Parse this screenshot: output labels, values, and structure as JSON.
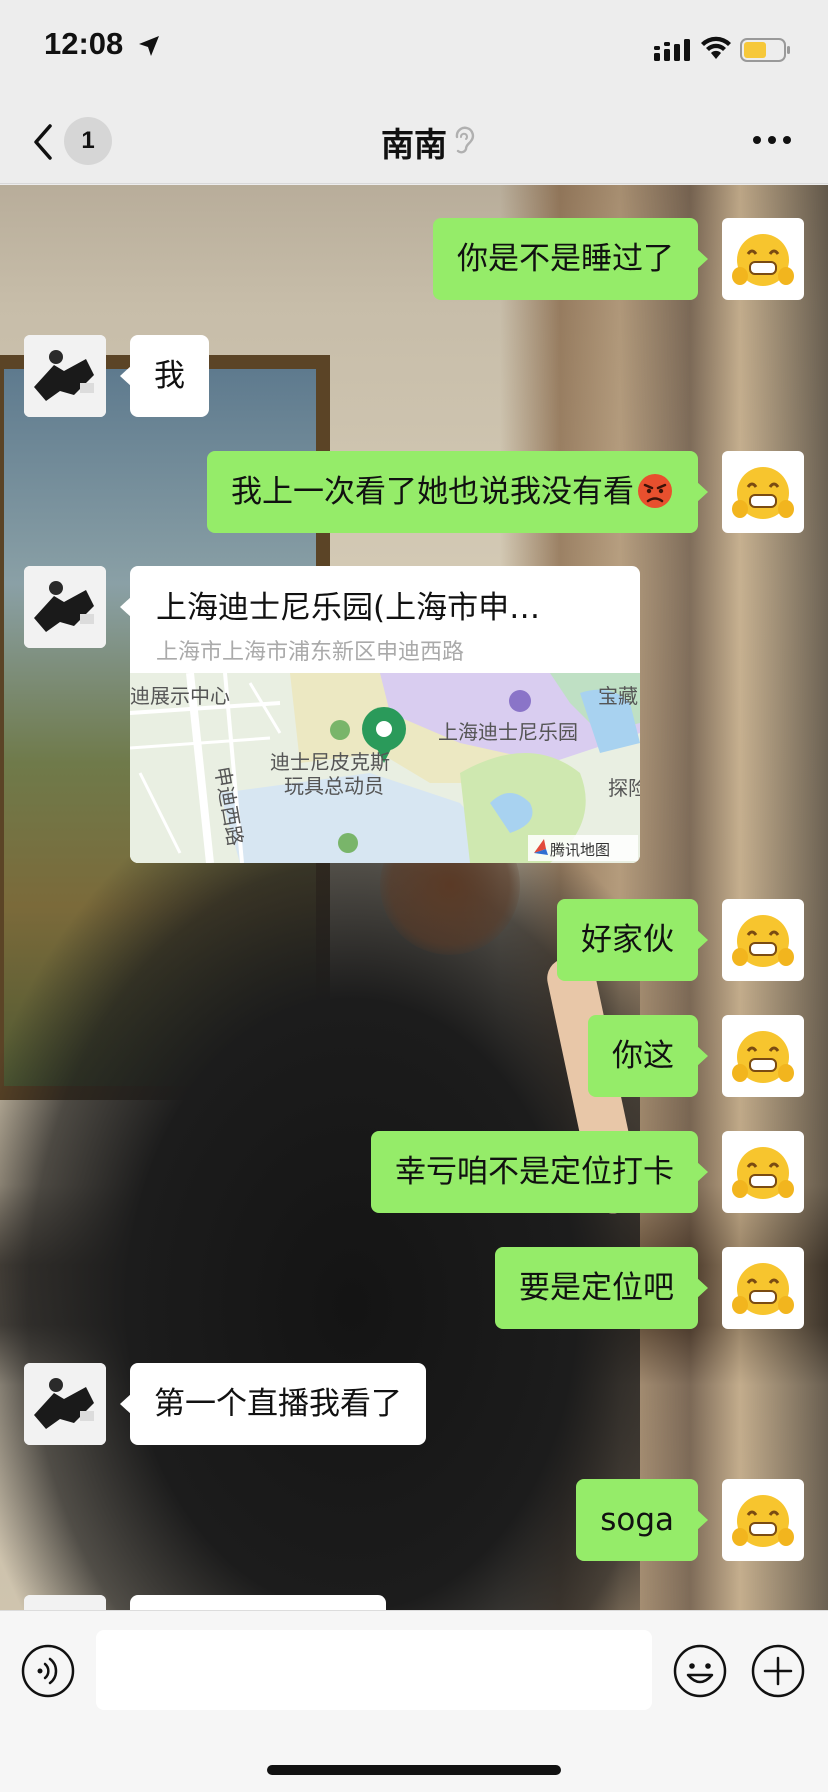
{
  "status_bar": {
    "time": "12:08",
    "icons": [
      "location-arrow-icon",
      "signal-icon",
      "wifi-icon",
      "battery-icon"
    ],
    "battery_color": "#f6c83a"
  },
  "nav": {
    "unread_count": "1",
    "title": "南南",
    "icons": [
      "back-icon",
      "ear-icon",
      "more-icon"
    ]
  },
  "colors": {
    "sent_bubble": "#95ec69",
    "received_bubble": "#ffffff",
    "bar_background": "#ededed"
  },
  "messages": [
    {
      "sender": "me",
      "text": "你是不是睡过了"
    },
    {
      "sender": "them",
      "text": "我"
    },
    {
      "sender": "me",
      "text": "我上一次看了她也说我没有看",
      "emoji": "angry-face-icon"
    },
    {
      "sender": "them",
      "type": "location",
      "title": "上海迪士尼乐园(上海市申…",
      "address": "上海市上海市浦东新区申迪西路",
      "map_labels": [
        "迪展示中心",
        "申迪西路",
        "迪士尼皮克斯",
        "玩具总动员",
        "上海迪士尼乐园",
        "宝藏",
        "探险",
        "腾讯地图"
      ]
    },
    {
      "sender": "me",
      "text": "好家伙"
    },
    {
      "sender": "me",
      "text": "你这"
    },
    {
      "sender": "me",
      "text": "幸亏咱不是定位打卡"
    },
    {
      "sender": "me",
      "text": "要是定位吧"
    },
    {
      "sender": "them",
      "text": "第一个直播我看了"
    },
    {
      "sender": "me",
      "text": "soga"
    }
  ],
  "input_bar": {
    "placeholder": "",
    "icons": [
      "voice-icon",
      "emoji-icon",
      "plus-icon"
    ]
  }
}
